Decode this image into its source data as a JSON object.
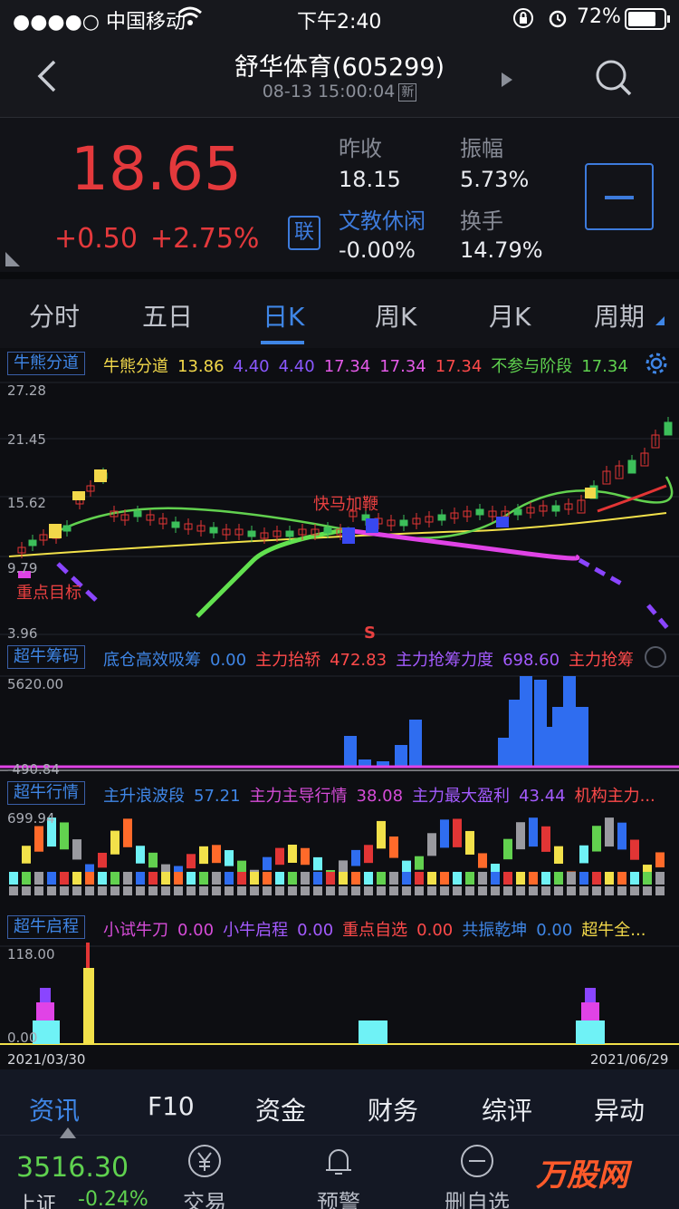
{
  "status_bar": {
    "carrier": "●●●●○ 中国移动",
    "time": "下午2:40",
    "battery": "72%"
  },
  "header": {
    "title": "舒华体育(605299)",
    "datetime": "08-13 15:00:04",
    "new_tag": "新"
  },
  "quote": {
    "price": "18.65",
    "change": "+0.50",
    "change_pct": "+2.75%",
    "link_button": "联",
    "prev_close_label": "昨收",
    "prev_close": "18.15",
    "amplitude_label": "振幅",
    "amplitude": "5.73%",
    "sector": "文教休闲",
    "sector_change": "-0.00%",
    "turnover_label": "换手",
    "turnover": "14.79%"
  },
  "tabs": [
    "分时",
    "五日",
    "日K",
    "周K",
    "月K",
    "周期"
  ],
  "active_tab": "日K",
  "indicators": {
    "bull_bear": {
      "box": "牛熊分道",
      "values": [
        {
          "t": "牛熊分道",
          "c": "#f2d84a"
        },
        {
          "t": "13.86",
          "c": "#f2d84a"
        },
        {
          "t": "4.40",
          "c": "#8a58ff"
        },
        {
          "t": "4.40",
          "c": "#8a58ff"
        },
        {
          "t": "17.34",
          "c": "#e45ae8"
        },
        {
          "t": "17.34",
          "c": "#e45ae8"
        },
        {
          "t": "17.34",
          "c": "#ff4a4a"
        },
        {
          "t": "不参与阶段",
          "c": "#5fd14f"
        },
        {
          "t": "17.34",
          "c": "#5fd14f"
        }
      ],
      "y_labels": [
        "27.28",
        "21.45",
        "15.62",
        "9.79",
        "3.96"
      ],
      "annotations": {
        "kuaima": "快马加鞭",
        "target": "重点目标",
        "s_mark": "S"
      }
    },
    "chips": {
      "box": "超牛筹码",
      "values": [
        {
          "t": "底仓高效吸筹",
          "c": "#3f86e6"
        },
        {
          "t": "0.00",
          "c": "#3f86e6"
        },
        {
          "t": "主力抬轿",
          "c": "#ff4a4a"
        },
        {
          "t": "472.83",
          "c": "#ff4a4a"
        },
        {
          "t": "主力抢筹力度",
          "c": "#a45bff"
        },
        {
          "t": "698.60",
          "c": "#a45bff"
        },
        {
          "t": "主力抢筹",
          "c": "#ff4a4a"
        }
      ],
      "y_labels": [
        "5620.00",
        "-490.84"
      ]
    },
    "trend": {
      "box": "超牛行情",
      "values": [
        {
          "t": "主升浪波段",
          "c": "#3f86e6"
        },
        {
          "t": "57.21",
          "c": "#3f86e6"
        },
        {
          "t": "主力主导行情",
          "c": "#d64cd8"
        },
        {
          "t": "38.08",
          "c": "#d64cd8"
        },
        {
          "t": "主力最大盈利",
          "c": "#a45bff"
        },
        {
          "t": "43.44",
          "c": "#a45bff"
        },
        {
          "t": "机构主力...",
          "c": "#ff4a4a"
        }
      ],
      "y_labels": [
        "699.94"
      ]
    },
    "start": {
      "box": "超牛启程",
      "values": [
        {
          "t": "小试牛刀",
          "c": "#d64cd8"
        },
        {
          "t": "0.00",
          "c": "#d64cd8"
        },
        {
          "t": "小牛启程",
          "c": "#a45bff"
        },
        {
          "t": "0.00",
          "c": "#a45bff"
        },
        {
          "t": "重点自选",
          "c": "#ff4a4a"
        },
        {
          "t": "0.00",
          "c": "#ff4a4a"
        },
        {
          "t": "共振乾坤",
          "c": "#3f86e6"
        },
        {
          "t": "0.00",
          "c": "#3f86e6"
        },
        {
          "t": "超牛全...",
          "c": "#f2d84a"
        }
      ],
      "y_labels": [
        "118.00",
        "0.00"
      ]
    }
  },
  "date_range": {
    "start": "2021/03/30",
    "end": "2021/06/29"
  },
  "bottom_tabs": [
    "资讯",
    "F10",
    "资金",
    "财务",
    "综评",
    "异动"
  ],
  "footer": {
    "index_value": "3516.30",
    "index_name": "上证",
    "index_change": "-0.24%",
    "trade": "交易",
    "alert": "预警",
    "remove": "删自选",
    "watermark": "万股网"
  }
}
